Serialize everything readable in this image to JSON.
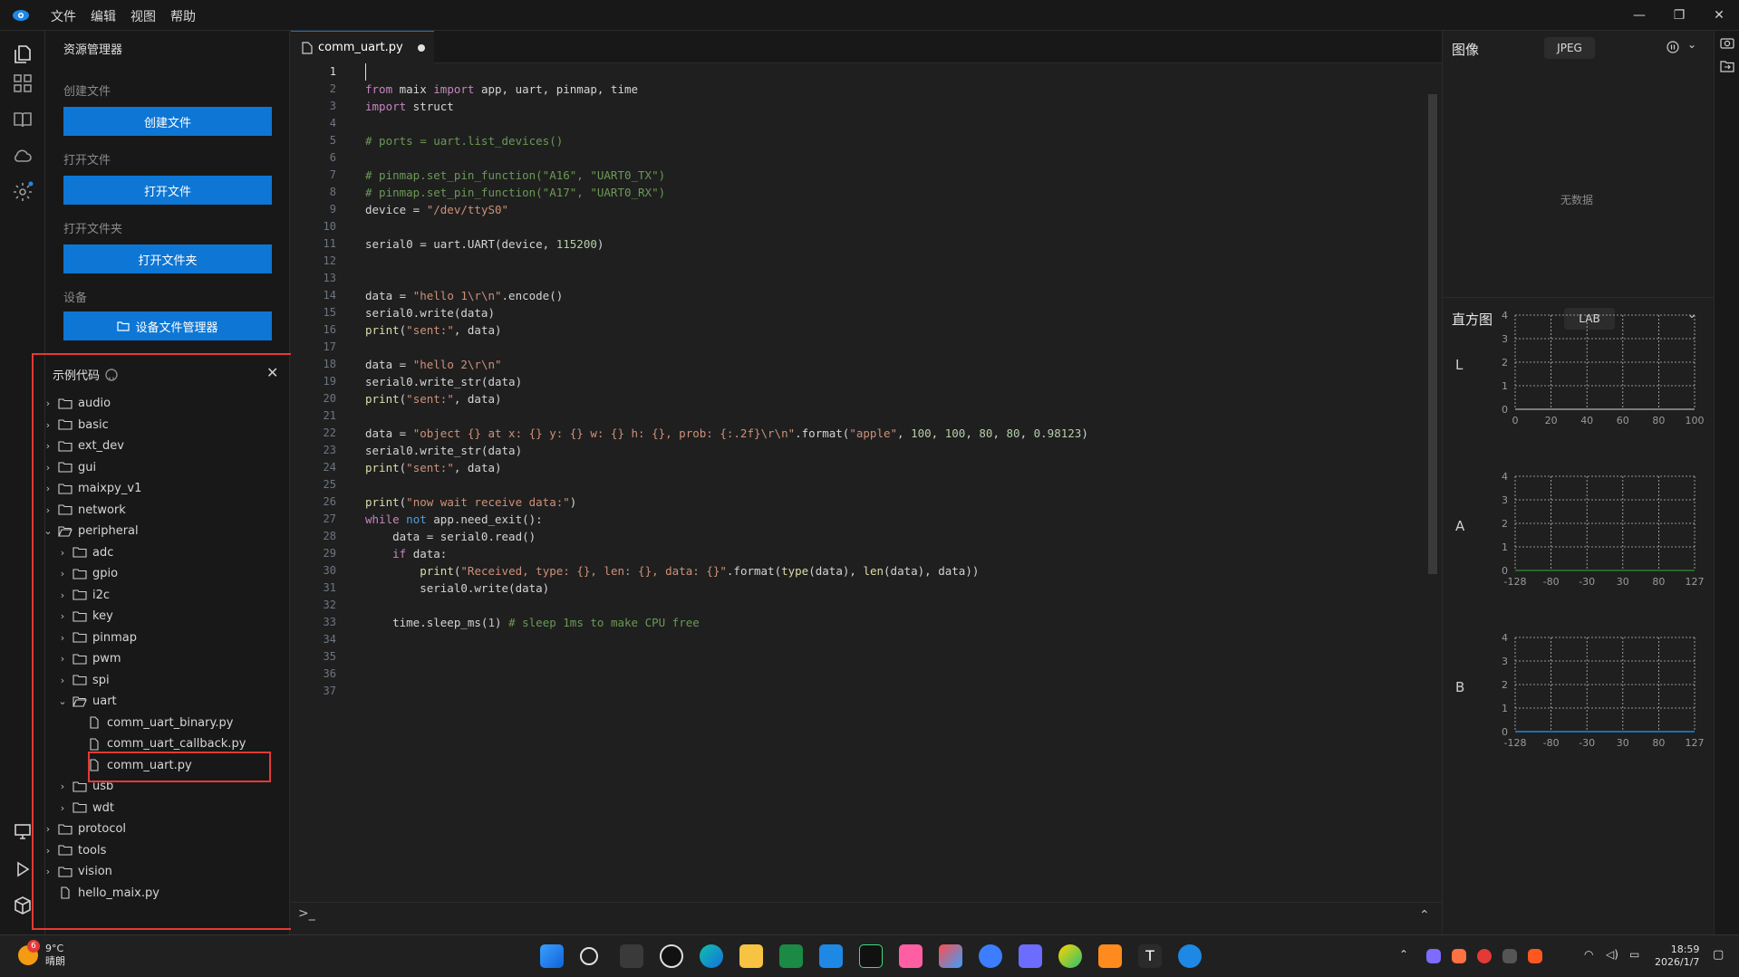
{
  "menu": [
    "文件",
    "编辑",
    "视图",
    "帮助"
  ],
  "sidebar": {
    "title": "资源管理器",
    "create_label": "创建文件",
    "create_button": "创建文件",
    "open_label": "打开文件",
    "open_button": "打开文件",
    "open_folder_label": "打开文件夹",
    "open_folder_button": "打开文件夹",
    "device_label": "设备",
    "device_button": "设备文件管理器"
  },
  "examples": {
    "title": "示例代码",
    "tree": [
      {
        "label": "audio",
        "type": "folder",
        "depth": 0,
        "open": false
      },
      {
        "label": "basic",
        "type": "folder",
        "depth": 0,
        "open": false
      },
      {
        "label": "ext_dev",
        "type": "folder",
        "depth": 0,
        "open": false
      },
      {
        "label": "gui",
        "type": "folder",
        "depth": 0,
        "open": false
      },
      {
        "label": "maixpy_v1",
        "type": "folder",
        "depth": 0,
        "open": false
      },
      {
        "label": "network",
        "type": "folder",
        "depth": 0,
        "open": false
      },
      {
        "label": "peripheral",
        "type": "folder",
        "depth": 0,
        "open": true
      },
      {
        "label": "adc",
        "type": "folder",
        "depth": 1,
        "open": false
      },
      {
        "label": "gpio",
        "type": "folder",
        "depth": 1,
        "open": false
      },
      {
        "label": "i2c",
        "type": "folder",
        "depth": 1,
        "open": false
      },
      {
        "label": "key",
        "type": "folder",
        "depth": 1,
        "open": false
      },
      {
        "label": "pinmap",
        "type": "folder",
        "depth": 1,
        "open": false
      },
      {
        "label": "pwm",
        "type": "folder",
        "depth": 1,
        "open": false
      },
      {
        "label": "spi",
        "type": "folder",
        "depth": 1,
        "open": false
      },
      {
        "label": "uart",
        "type": "folder",
        "depth": 1,
        "open": true
      },
      {
        "label": "comm_uart_binary.py",
        "type": "file",
        "depth": 2
      },
      {
        "label": "comm_uart_callback.py",
        "type": "file",
        "depth": 2
      },
      {
        "label": "comm_uart.py",
        "type": "file",
        "depth": 2
      },
      {
        "label": "usb",
        "type": "folder",
        "depth": 1,
        "open": false
      },
      {
        "label": "wdt",
        "type": "folder",
        "depth": 1,
        "open": false
      },
      {
        "label": "protocol",
        "type": "folder",
        "depth": 0,
        "open": false
      },
      {
        "label": "tools",
        "type": "folder",
        "depth": 0,
        "open": false
      },
      {
        "label": "vision",
        "type": "folder",
        "depth": 0,
        "open": false
      },
      {
        "label": "hello_maix.py",
        "type": "file",
        "depth": 0
      }
    ]
  },
  "editor": {
    "tab": "comm_uart.py",
    "lines": [
      "",
      "<span class=\"kw\">from</span> maix <span class=\"kw\">import</span> app, uart, pinmap, time",
      "<span class=\"kw\">import</span> struct",
      "",
      "<span class=\"cm\"># ports = uart.list_devices()</span>",
      "",
      "<span class=\"cm\"># pinmap.set_pin_function(\"A16\", \"UART0_TX\")</span>",
      "<span class=\"cm\"># pinmap.set_pin_function(\"A17\", \"UART0_RX\")</span>",
      "device = <span class=\"st\">\"/dev/ttyS0\"</span>",
      "",
      "serial0 = uart.UART(device, <span class=\"nu\">115200</span>)",
      "",
      "",
      "data = <span class=\"st\">\"hello 1\\r\\n\"</span>.encode()",
      "serial0.write(data)",
      "<span class=\"fn\">print</span>(<span class=\"st\">\"sent:\"</span>, data)",
      "",
      "data = <span class=\"st\">\"hello 2\\r\\n\"</span>",
      "serial0.write_str(data)",
      "<span class=\"fn\">print</span>(<span class=\"st\">\"sent:\"</span>, data)",
      "",
      "data = <span class=\"st\">\"object {} at x: {} y: {} w: {} h: {}, prob: {:.2f}\\r\\n\"</span>.format(<span class=\"st\">\"apple\"</span>, <span class=\"nu\">100</span>, <span class=\"nu\">100</span>, <span class=\"nu\">80</span>, <span class=\"nu\">80</span>, <span class=\"nu\">0.98123</span>)",
      "serial0.write_str(data)",
      "<span class=\"fn\">print</span>(<span class=\"st\">\"sent:\"</span>, data)",
      "",
      "<span class=\"fn\">print</span>(<span class=\"st\">\"now wait receive data:\"</span>)",
      "<span class=\"kw\">while</span> <span class=\"kb\">not</span> app.need_exit():",
      "    data = serial0.read()",
      "    <span class=\"kw\">if</span> data:",
      "        <span class=\"fn\">print</span>(<span class=\"st\">\"Received, type: {}, len: {}, data: {}\"</span>.format(<span class=\"fn\">type</span>(data), <span class=\"fn\">len</span>(data), data))",
      "        serial0.write(data)",
      "",
      "    time.sleep_ms(<span class=\"nu\">1</span>) <span class=\"cm\"># sleep 1ms to make CPU free</span>",
      "",
      "",
      "",
      ""
    ]
  },
  "image_panel": {
    "title": "图像",
    "format": "JPEG",
    "nodata": "无数据"
  },
  "histogram": {
    "title": "直方图",
    "mode": "LAB",
    "channels": [
      {
        "name": "L",
        "yticks": [
          "4",
          "3",
          "2",
          "1",
          "0"
        ],
        "xticks": [
          "0",
          "20",
          "40",
          "60",
          "80",
          "100"
        ]
      },
      {
        "name": "A",
        "yticks": [
          "4",
          "3",
          "2",
          "1",
          "0"
        ],
        "xticks": [
          "-128",
          "-80",
          "-30",
          "30",
          "80",
          "127"
        ]
      },
      {
        "name": "B",
        "yticks": [
          "4",
          "3",
          "2",
          "1",
          "0"
        ],
        "xticks": [
          "-128",
          "-80",
          "-30",
          "30",
          "80",
          "127"
        ]
      }
    ]
  },
  "taskbar": {
    "temp": "9°C",
    "weather": "晴朗",
    "badge": "6",
    "time": "18:59",
    "date": "2026/1/7"
  }
}
